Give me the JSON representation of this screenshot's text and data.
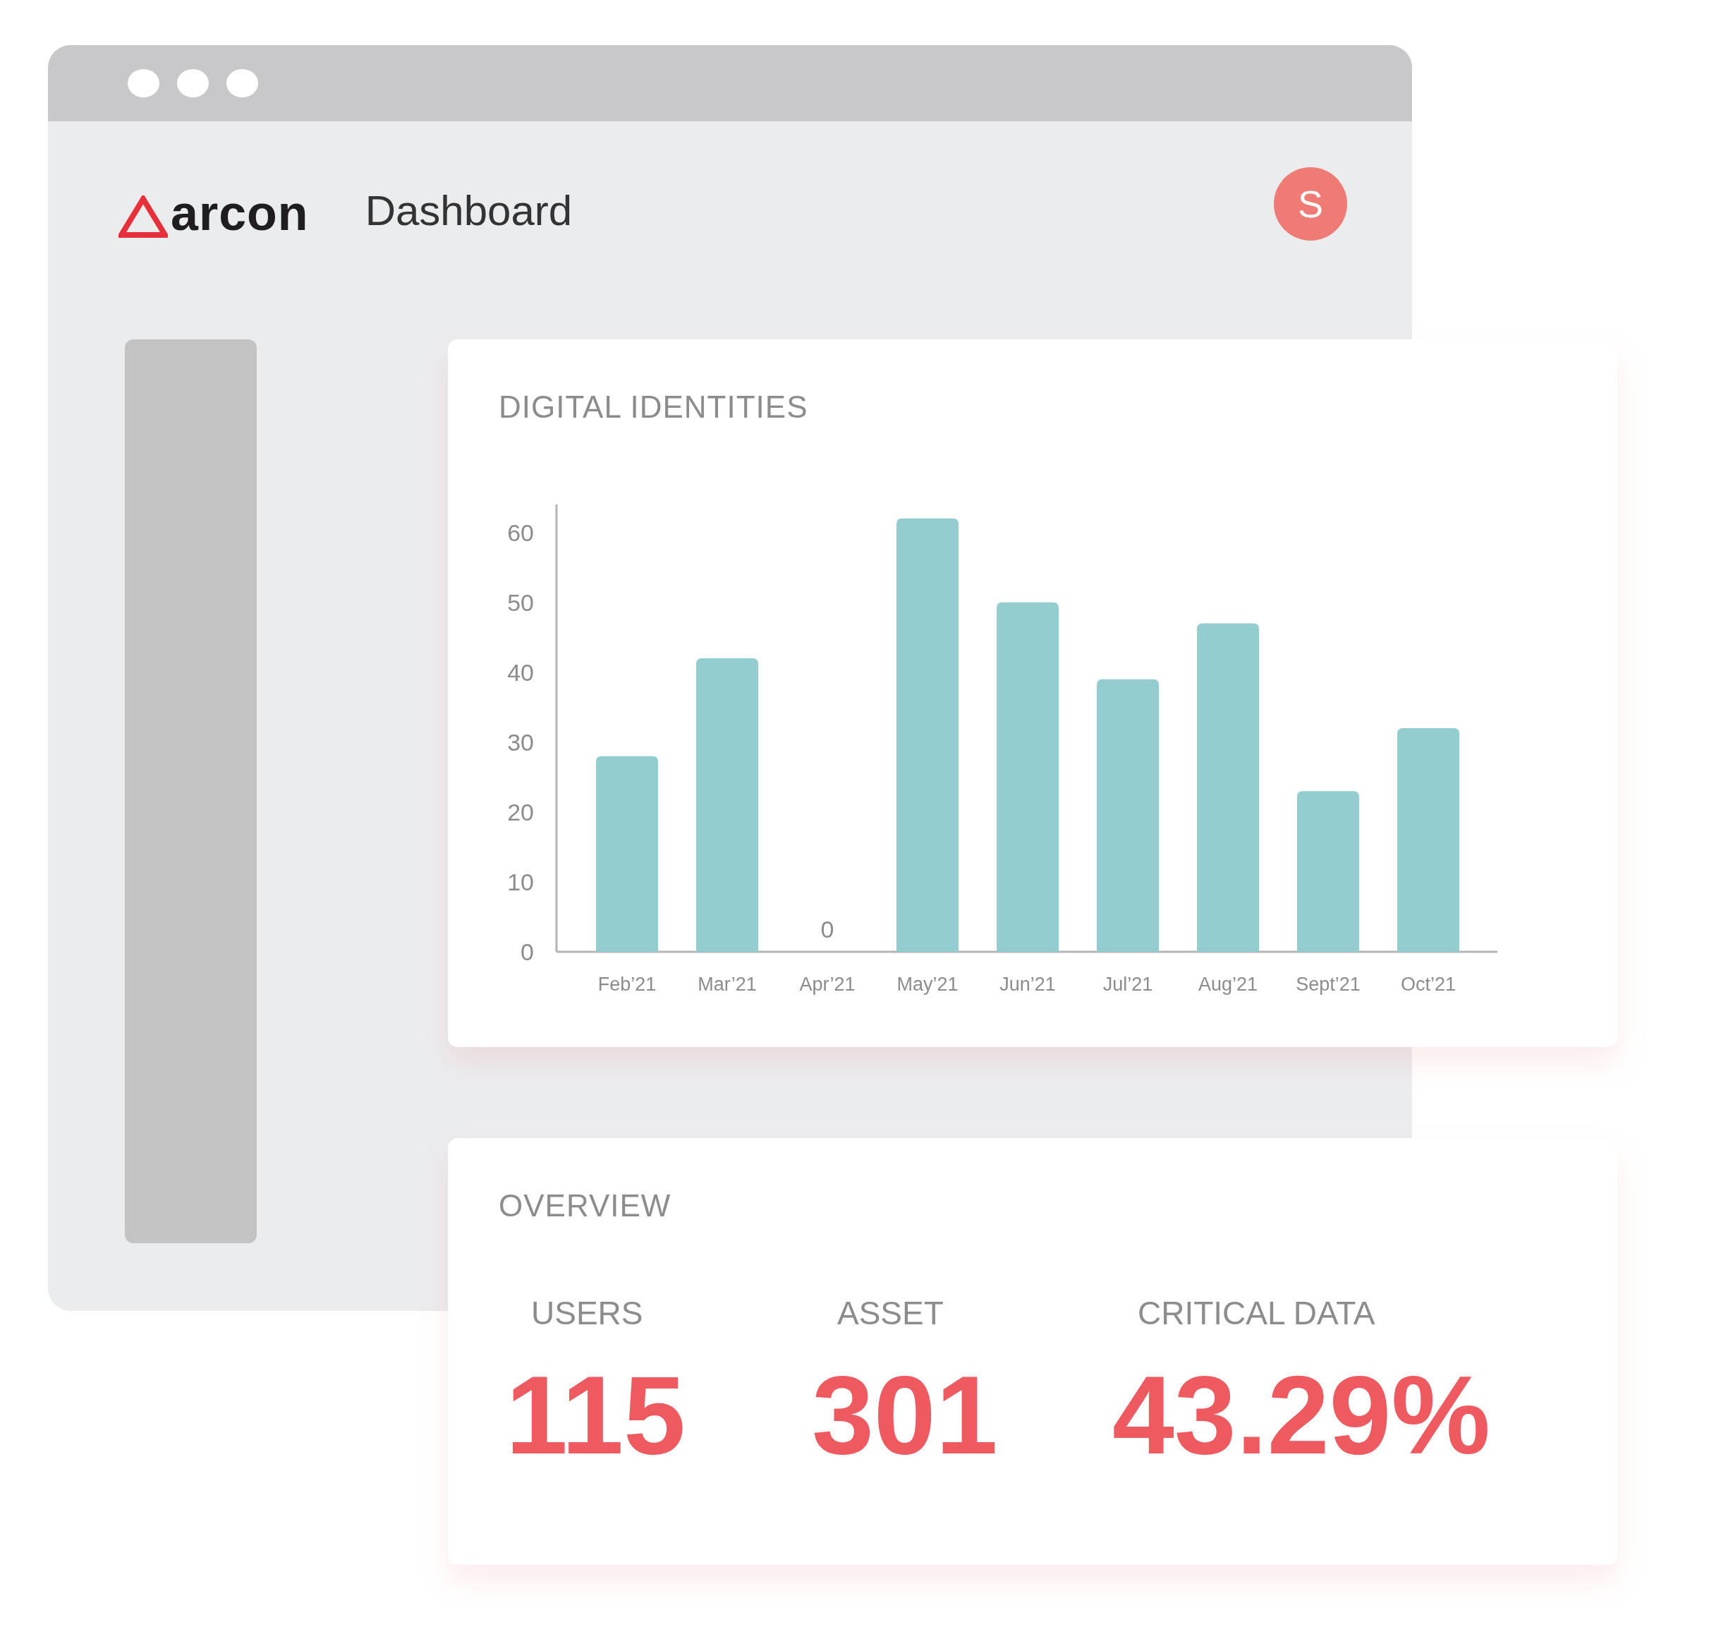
{
  "header": {
    "logo": "arcon",
    "title": "Dashboard",
    "avatar": "S"
  },
  "chart_card": {
    "title": "DIGITAL IDENTITIES",
    "chart_data": {
      "type": "bar",
      "categories": [
        "Feb’21",
        "Mar’21",
        "Apr’21",
        "May’21",
        "Jun’21",
        "Jul’21",
        "Aug’21",
        "Sept’21",
        "Oct’21"
      ],
      "values": [
        28,
        42,
        0,
        62,
        50,
        39,
        47,
        23,
        32
      ],
      "ylim": [
        0,
        64
      ],
      "yticks": [
        0,
        10,
        20,
        30,
        40,
        50,
        60
      ],
      "annotations": [
        {
          "x": "Apr’21",
          "y": 0,
          "text": "0"
        }
      ]
    }
  },
  "overview": {
    "title": "OVERVIEW",
    "stats": [
      {
        "label": "USERS",
        "value": "115"
      },
      {
        "label": "ASSET",
        "value": "301"
      },
      {
        "label": "CRITICAL DATA",
        "value": "43.29%"
      }
    ]
  }
}
